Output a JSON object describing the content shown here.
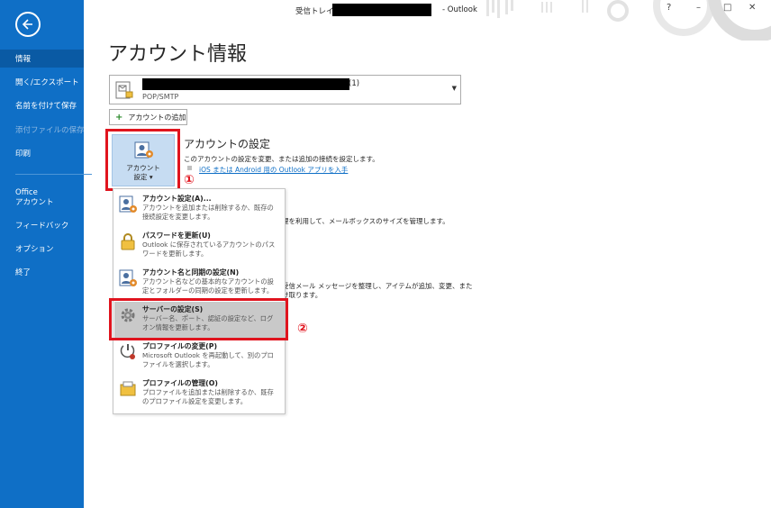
{
  "titlebar": {
    "prefix": "受信トレイ -",
    "suffix": "- Outlook",
    "help": "?",
    "minimize": "–",
    "maximize": "□",
    "close": "✕"
  },
  "sidebar": {
    "items": [
      {
        "label": "情報"
      },
      {
        "label": "開く/エクスポート"
      },
      {
        "label": "名前を付けて保存"
      },
      {
        "label": "添付ファイルの保存"
      },
      {
        "label": "印刷"
      },
      {
        "label": "Office"
      },
      {
        "label": "アカウント"
      },
      {
        "label": "フィードバック"
      },
      {
        "label": "オプション"
      },
      {
        "label": "終了"
      }
    ]
  },
  "page": {
    "title": "アカウント情報"
  },
  "account": {
    "name_suffix": "(1)",
    "type": "POP/SMTP"
  },
  "add_account": {
    "label": "アカウントの追加"
  },
  "settings_button": {
    "line1": "アカウント",
    "line2": "設定",
    "caret": "▾"
  },
  "section": {
    "title": "アカウントの設定",
    "desc": "このアカウントの設定を変更、または追加の接続を設定します。",
    "link": "iOS または Android 用の Outlook アプリを入手"
  },
  "background": {
    "line1": "理を利用して、メールボックスのサイズを管理します。",
    "line2": "受信メール メッセージを整理し、アイテムが追加、変更、また",
    "line3": "け取ります。"
  },
  "annotations": {
    "one": "①",
    "two": "②"
  },
  "menu": {
    "items": [
      {
        "title": "アカウント設定(A)...",
        "desc": "アカウントを追加または削除するか、既存の接続設定を変更します。"
      },
      {
        "title": "パスワードを更新(U)",
        "desc": "Outlook に保存されているアカウントのパスワードを更新します。"
      },
      {
        "title": "アカウント名と同期の設定(N)",
        "desc": "アカウント名などの基本的なアカウントの設定とフォルダーの同期の設定を更新します。"
      },
      {
        "title": "サーバーの設定(S)",
        "desc": "サーバー名、ポート、認証の設定など、ログオン情報を更新します。"
      },
      {
        "title": "プロファイルの変更(P)",
        "desc": "Microsoft Outlook を再起動して、別のプロファイルを選択します。"
      },
      {
        "title": "プロファイルの管理(O)",
        "desc": "プロファイルを追加または削除するか、既存のプロファイル設定を変更します。"
      }
    ]
  },
  "colors": {
    "sidebar": "#0f6fc6",
    "highlight": "#e0141e",
    "menu_selected": "#c9c9c9"
  }
}
